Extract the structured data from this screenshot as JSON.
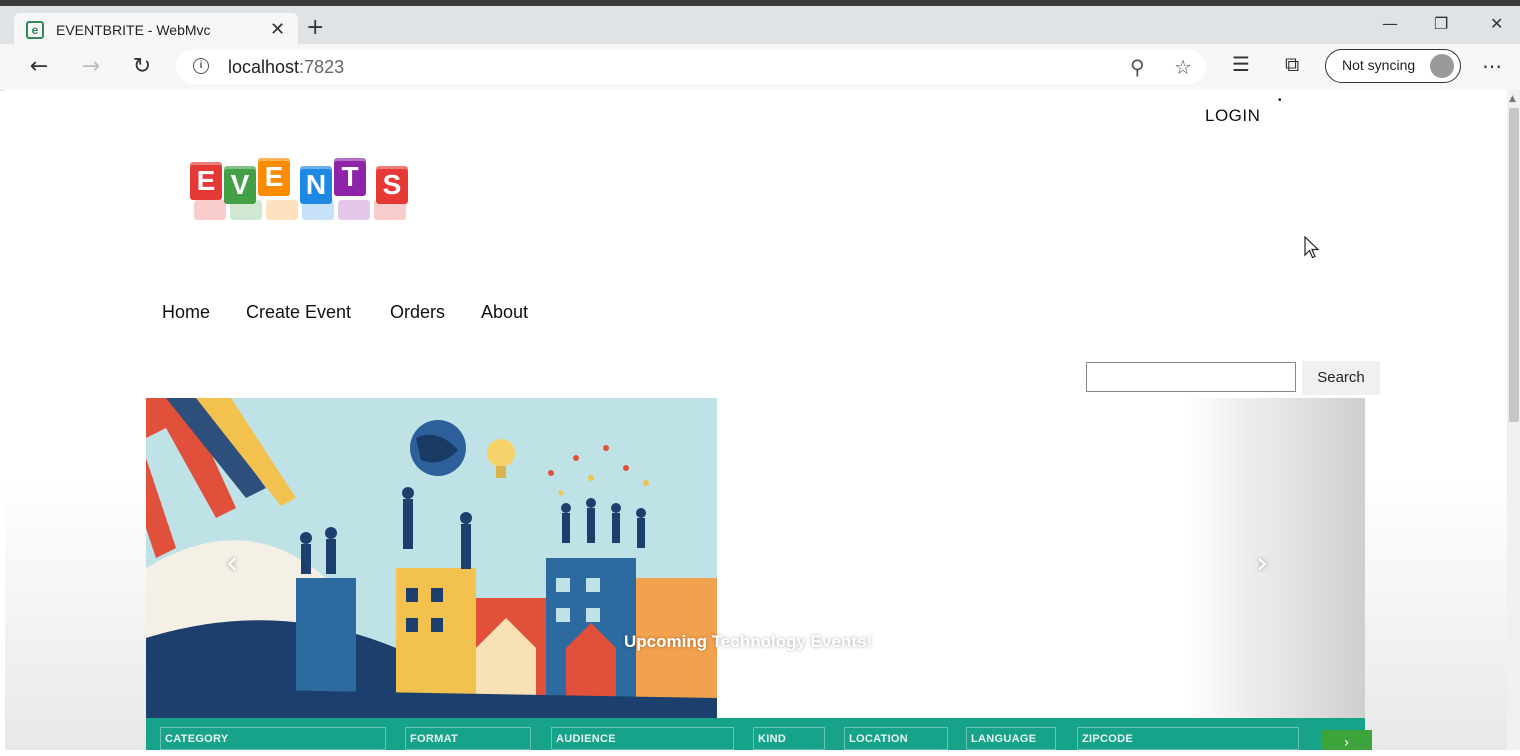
{
  "browser": {
    "tab_title": "EVENTBRITE - WebMvc",
    "favicon": "e",
    "new_tab": "+",
    "url_host": "localhost",
    "url_port": ":7823",
    "sync_label": "Not syncing"
  },
  "header": {
    "login": "LOGIN",
    "logo_letters": [
      "E",
      "V",
      "E",
      "N",
      "T",
      "S"
    ]
  },
  "nav": {
    "items": [
      "Home",
      "Create Event",
      "Orders",
      "About"
    ]
  },
  "search": {
    "value": "",
    "button": "Search"
  },
  "carousel": {
    "caption": "Upcoming Technology Events!",
    "prev": "‹",
    "next": "›"
  },
  "filters": {
    "labels": [
      "CATEGORY",
      "FORMAT",
      "AUDIENCE",
      "KIND",
      "LOCATION",
      "LANGUAGE",
      "ZIPCODE"
    ],
    "go": "›"
  },
  "colors": {
    "teal": "#17a38a",
    "green": "#3da43c",
    "cube_colors": [
      "#e53935",
      "#43a047",
      "#fb8c00",
      "#1e88e5",
      "#8e24aa",
      "#e53935"
    ]
  }
}
